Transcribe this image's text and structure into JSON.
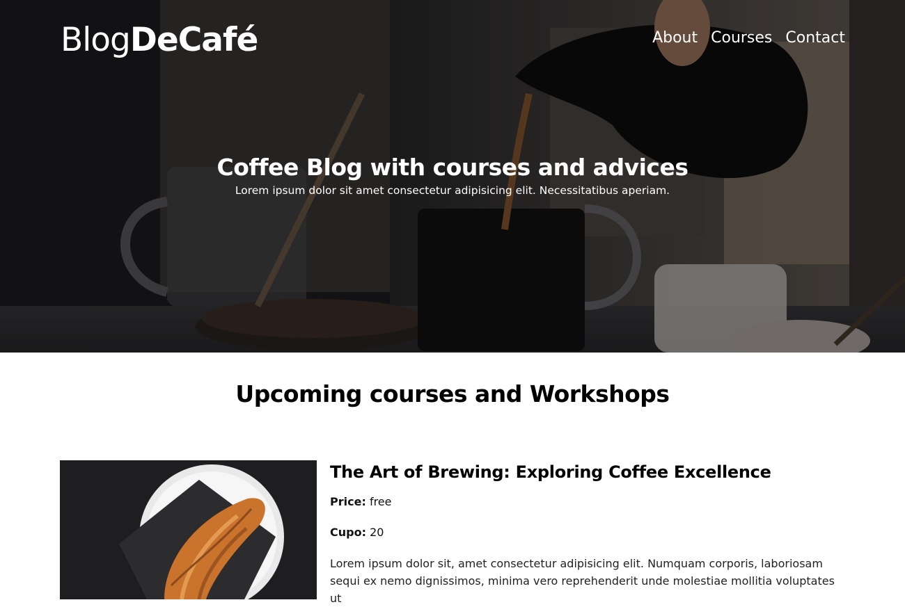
{
  "header": {
    "logo_light": "Blog",
    "logo_bold": "DeCafé",
    "nav": [
      {
        "label": "About"
      },
      {
        "label": "Courses"
      },
      {
        "label": "Contact"
      }
    ]
  },
  "hero": {
    "title": "Coffee Blog with courses and advices",
    "subtitle": "Lorem ipsum dolor sit amet consectetur adipisicing elit. Necessitatibus aperiam."
  },
  "courses_section": {
    "title": "Upcoming courses and Workshops",
    "courses": [
      {
        "title": "The Art of Brewing: Exploring Coffee Excellence",
        "price_label": "Price:",
        "price_value": "free",
        "cupo_label": "Cupo:",
        "cupo_value": "20",
        "description": "Lorem ipsum dolor sit, amet consectetur adipisicing elit. Numquam corporis, laboriosam sequi ex nemo dignissimos, minima vero reprehenderit unde molestiae mollitia voluptates ut"
      }
    ]
  },
  "colors": {
    "hero_overlay": "#000000",
    "text_light": "#ffffff",
    "text_dark": "#000000"
  }
}
